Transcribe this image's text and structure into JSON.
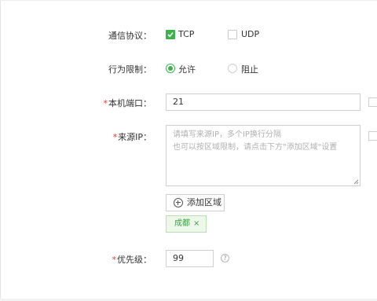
{
  "form": {
    "protocol": {
      "label": "通信协议：",
      "options": [
        {
          "text": "TCP",
          "checked": true
        },
        {
          "text": "UDP",
          "checked": false
        }
      ]
    },
    "behavior": {
      "label": "行为限制：",
      "options": [
        {
          "text": "允许",
          "selected": true
        },
        {
          "text": "阻止",
          "selected": false
        }
      ]
    },
    "local_port": {
      "required_mark": "*",
      "label": "本机端口：",
      "value": "21"
    },
    "source_ip": {
      "required_mark": "*",
      "label": "来源IP：",
      "placeholder_line1": "请填写来源IP，多个IP换行分隔",
      "placeholder_line2": "也可以按区域限制，请点击下方\"添加区域\"设置"
    },
    "add_region_button": "添加区域",
    "region_tags": [
      {
        "text": "成都",
        "close": "×"
      }
    ],
    "priority": {
      "required_mark": "*",
      "label": "优先级：",
      "value": "99",
      "help": "?"
    }
  },
  "colors": {
    "accent_green": "#3bb34a",
    "required_red": "#e4393c",
    "tag_bg": "#eef8ea"
  },
  "icons": [
    "checkmark-icon",
    "plus-circle-icon",
    "close-icon",
    "help-icon",
    "resize-grip-icon"
  ]
}
